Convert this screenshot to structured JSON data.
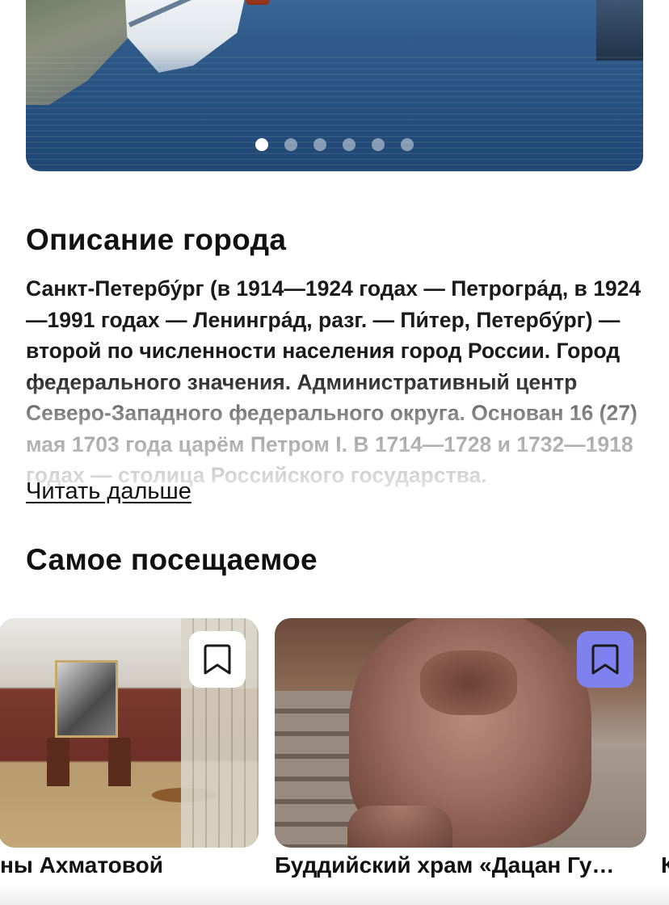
{
  "hero": {
    "active_index": 0,
    "dot_count": 6
  },
  "description": {
    "title": "Описание города",
    "text": "Санкт-Петербу́рг (в 1914—1924 годах — Петрогра́д, в 1924—1991 годах — Ленингра́д, разг. — Пи́тер, Петербу́рг) — второй по численности населения город России. Город федерального значения. Административный центр Северо-Западного федерального округа. Основан 16 (27) мая 1703 года царём Петром I. В 1714—1728 и 1732—1918 годах — столица Российского государства.",
    "read_more": "Читать дальше"
  },
  "most_visited": {
    "title": "Самое посещаемое",
    "cards": [
      {
        "caption": "ны Ахматовой",
        "bookmarked": false
      },
      {
        "caption": "Буддийский храм «Дацан Гу…",
        "bookmarked": true
      },
      {
        "caption": "К",
        "bookmarked": false
      }
    ]
  },
  "colors": {
    "bookmark_active": "#7f82ee",
    "bookmark_default": "#ffffff",
    "text": "#111111"
  }
}
